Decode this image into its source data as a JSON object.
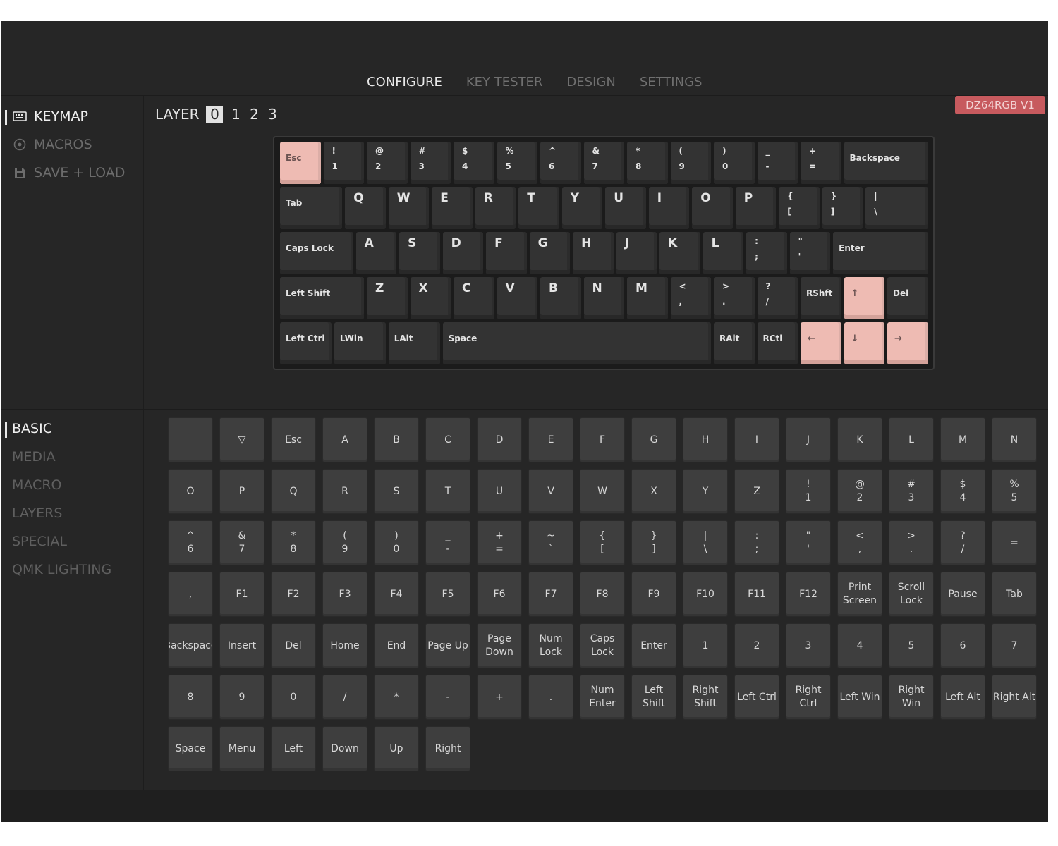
{
  "nav": {
    "tabs": [
      {
        "label": "CONFIGURE",
        "active": true
      },
      {
        "label": "KEY TESTER",
        "active": false
      },
      {
        "label": "DESIGN",
        "active": false
      },
      {
        "label": "SETTINGS",
        "active": false
      }
    ]
  },
  "sidebar_top": {
    "items": [
      {
        "label": "KEYMAP",
        "icon": "keyboard-icon",
        "active": true
      },
      {
        "label": "MACROS",
        "icon": "target-icon",
        "active": false
      },
      {
        "label": "SAVE + LOAD",
        "icon": "floppy-disk-icon",
        "active": false
      }
    ]
  },
  "layers": {
    "label": "LAYER",
    "items": [
      {
        "label": "0",
        "active": true
      },
      {
        "label": "1",
        "active": false
      },
      {
        "label": "2",
        "active": false
      },
      {
        "label": "3",
        "active": false
      }
    ]
  },
  "device": {
    "name": "DZ64RGB V1"
  },
  "keyboard": {
    "rows": [
      [
        {
          "label": "Esc",
          "accent": true
        },
        {
          "top": "!",
          "bottom": "1"
        },
        {
          "top": "@",
          "bottom": "2"
        },
        {
          "top": "#",
          "bottom": "3"
        },
        {
          "top": "$",
          "bottom": "4"
        },
        {
          "top": "%",
          "bottom": "5"
        },
        {
          "top": "^",
          "bottom": "6"
        },
        {
          "top": "&",
          "bottom": "7"
        },
        {
          "top": "*",
          "bottom": "8"
        },
        {
          "top": "(",
          "bottom": "9"
        },
        {
          "top": ")",
          "bottom": "0"
        },
        {
          "top": "_",
          "bottom": "-"
        },
        {
          "top": "+",
          "bottom": "="
        },
        {
          "label": "Backspace"
        }
      ],
      [
        {
          "label": "Tab"
        },
        {
          "big": "Q"
        },
        {
          "big": "W"
        },
        {
          "big": "E"
        },
        {
          "big": "R"
        },
        {
          "big": "T"
        },
        {
          "big": "Y"
        },
        {
          "big": "U"
        },
        {
          "big": "I"
        },
        {
          "big": "O"
        },
        {
          "big": "P"
        },
        {
          "top": "{",
          "bottom": "["
        },
        {
          "top": "}",
          "bottom": "]"
        },
        {
          "top": "|",
          "bottom": "\\"
        }
      ],
      [
        {
          "label": "Caps Lock"
        },
        {
          "big": "A"
        },
        {
          "big": "S"
        },
        {
          "big": "D"
        },
        {
          "big": "F"
        },
        {
          "big": "G"
        },
        {
          "big": "H"
        },
        {
          "big": "J"
        },
        {
          "big": "K"
        },
        {
          "big": "L"
        },
        {
          "top": ":",
          "bottom": ";"
        },
        {
          "top": "\"",
          "bottom": "'"
        },
        {
          "label": "Enter"
        }
      ],
      [
        {
          "label": "Left Shift"
        },
        {
          "big": "Z"
        },
        {
          "big": "X"
        },
        {
          "big": "C"
        },
        {
          "big": "V"
        },
        {
          "big": "B"
        },
        {
          "big": "N"
        },
        {
          "big": "M"
        },
        {
          "top": "<",
          "bottom": ","
        },
        {
          "top": ">",
          "bottom": "."
        },
        {
          "top": "?",
          "bottom": "/"
        },
        {
          "label": "RShft"
        },
        {
          "arrow": "↑",
          "accent": true
        },
        {
          "label": "Del"
        }
      ],
      [
        {
          "label": "Left Ctrl"
        },
        {
          "label": "LWin"
        },
        {
          "label": "LAlt"
        },
        {
          "label": "Space"
        },
        {
          "label": "RAlt"
        },
        {
          "label": "RCtl"
        },
        {
          "arrow": "←",
          "accent": true
        },
        {
          "arrow": "↓",
          "accent": true
        },
        {
          "arrow": "→",
          "accent": true
        }
      ]
    ]
  },
  "sidebar_bottom": {
    "items": [
      {
        "label": "BASIC",
        "active": true
      },
      {
        "label": "MEDIA",
        "active": false
      },
      {
        "label": "MACRO",
        "active": false
      },
      {
        "label": "LAYERS",
        "active": false
      },
      {
        "label": "SPECIAL",
        "active": false
      },
      {
        "label": "QMK LIGHTING",
        "active": false
      }
    ]
  },
  "keycodes": [
    "",
    "▽",
    "Esc",
    "A",
    "B",
    "C",
    "D",
    "E",
    "F",
    "G",
    "H",
    "I",
    "J",
    "K",
    "L",
    "M",
    "N",
    "O",
    "P",
    "Q",
    "R",
    "S",
    "T",
    "U",
    "V",
    "W",
    "X",
    "Y",
    "Z",
    "!\n1",
    "@\n2",
    "#\n3",
    "$\n4",
    "%\n5",
    "^\n6",
    "&\n7",
    "*\n8",
    "(\n9",
    ")\n0",
    "_\n-",
    "+\n=",
    "~\n`",
    "{\n[",
    "}\n]",
    "|\n\\",
    ":\n;",
    "\"\n'",
    "<\n,",
    ">\n.",
    "?\n/",
    "=",
    ",",
    "F1",
    "F2",
    "F3",
    "F4",
    "F5",
    "F6",
    "F7",
    "F8",
    "F9",
    "F10",
    "F11",
    "F12",
    "Print\nScreen",
    "Scroll\nLock",
    "Pause",
    "Tab",
    "Backspace",
    "Insert",
    "Del",
    "Home",
    "End",
    "Page Up",
    "Page\nDown",
    "Num\nLock",
    "Caps\nLock",
    "Enter",
    "1",
    "2",
    "3",
    "4",
    "5",
    "6",
    "7",
    "8",
    "9",
    "0",
    "/",
    "*",
    "-",
    "+",
    ".",
    "Num\nEnter",
    "Left\nShift",
    "Right\nShift",
    "Left Ctrl",
    "Right\nCtrl",
    "Left Win",
    "Right\nWin",
    "Left Alt",
    "Right Alt",
    "Space",
    "Menu",
    "Left",
    "Down",
    "Up",
    "Right"
  ],
  "colors": {
    "accent_key": "#eebbb3",
    "badge": "#c75a5e",
    "background": "#262626"
  }
}
